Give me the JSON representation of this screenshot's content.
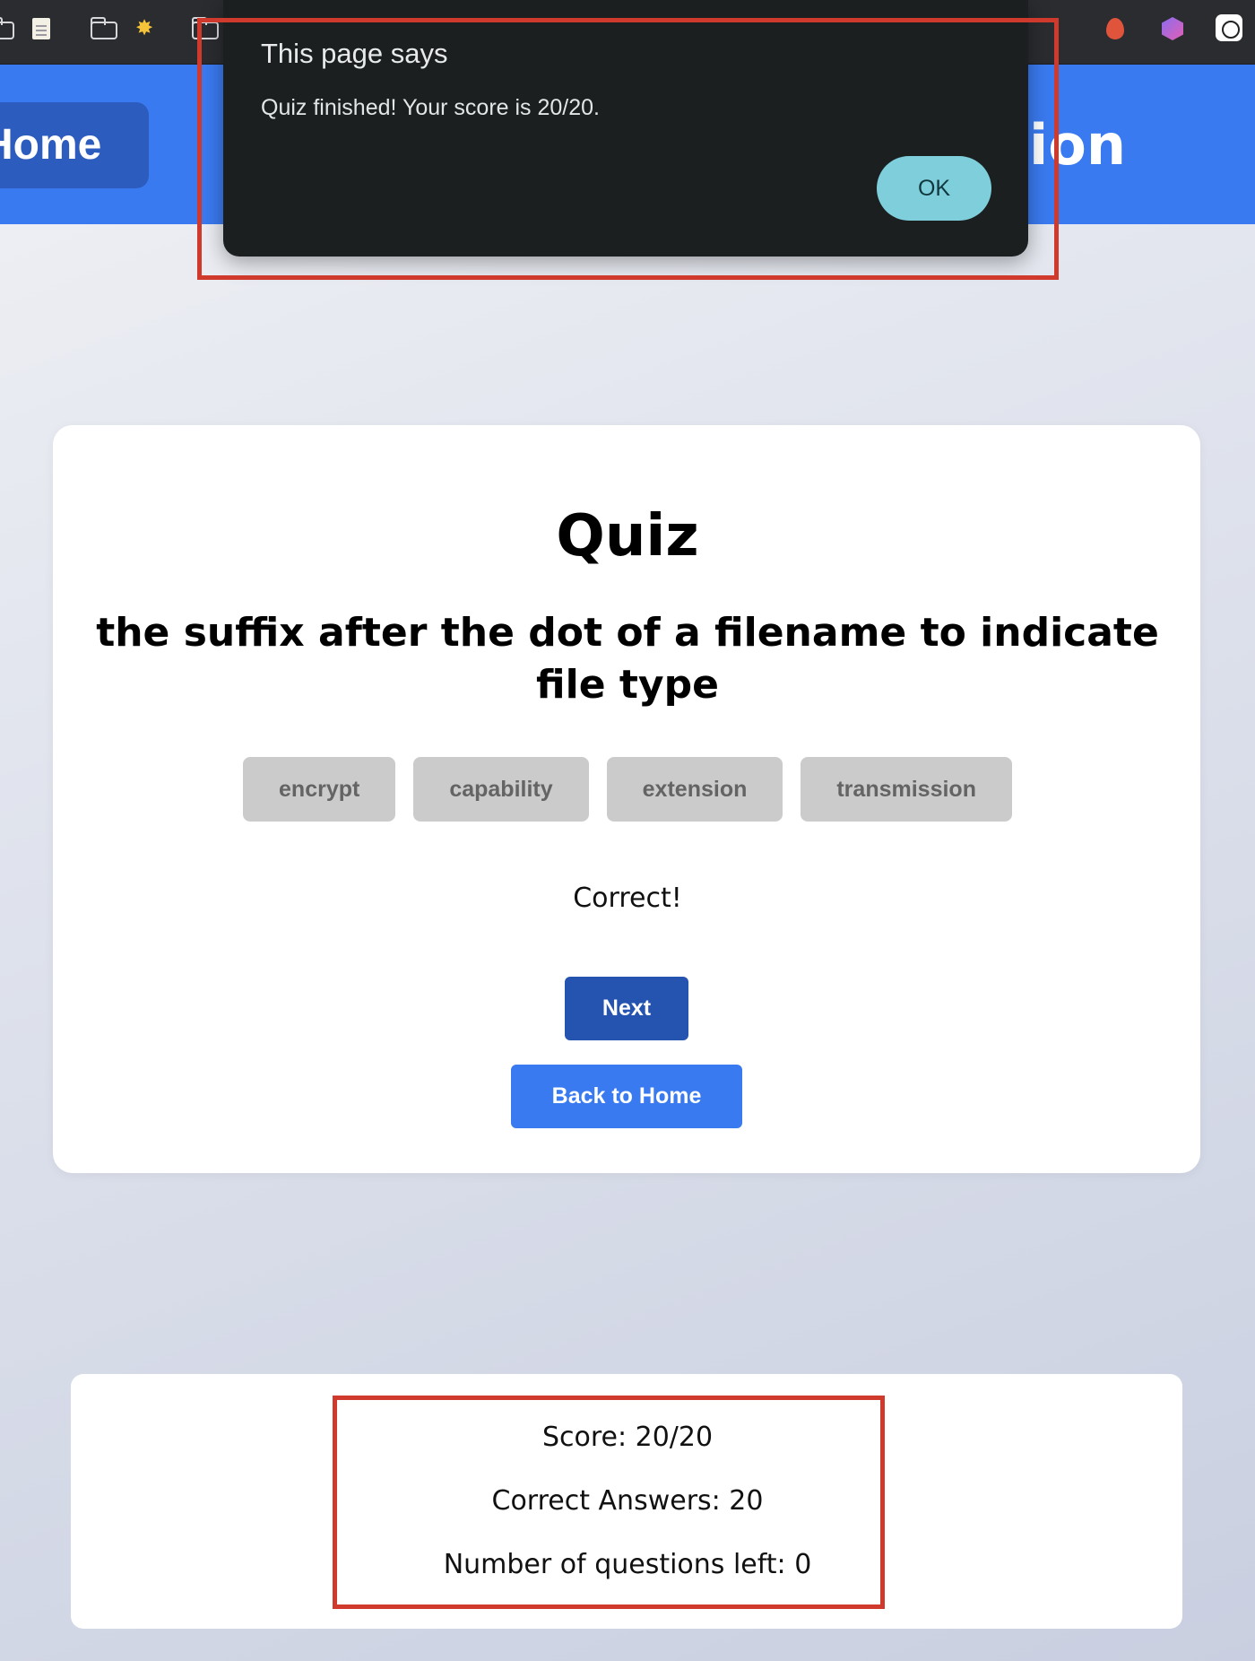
{
  "browser": {
    "toolbar_icons": [
      "folder-icon",
      "memo-icon",
      "folder-icon",
      "star-icon",
      "folder-icon",
      "flame-icon",
      "cube-icon",
      "ai-assistant-icon"
    ]
  },
  "header": {
    "home_label": "Home",
    "title": "Quiz Application"
  },
  "alert": {
    "title": "This page says",
    "message": "Quiz finished! Your score is 20/20.",
    "ok_label": "OK"
  },
  "quiz": {
    "title": "Quiz",
    "question": "the suffix after the dot of a filename to indicate file type",
    "options": [
      "encrypt",
      "capability",
      "extension",
      "transmission"
    ],
    "feedback": "Correct!",
    "next_label": "Next",
    "back_home_label": "Back to Home"
  },
  "stats": {
    "score": "Score: 20/20",
    "correct": "Correct Answers: 20",
    "remaining": "Number of questions left: 0"
  },
  "colors": {
    "header_blue": "#3a7af0",
    "next_button": "#2454b0",
    "alert_bg": "#1b1f20",
    "ok_button": "#7ecfdb",
    "highlight_red": "#cf3a2c"
  }
}
